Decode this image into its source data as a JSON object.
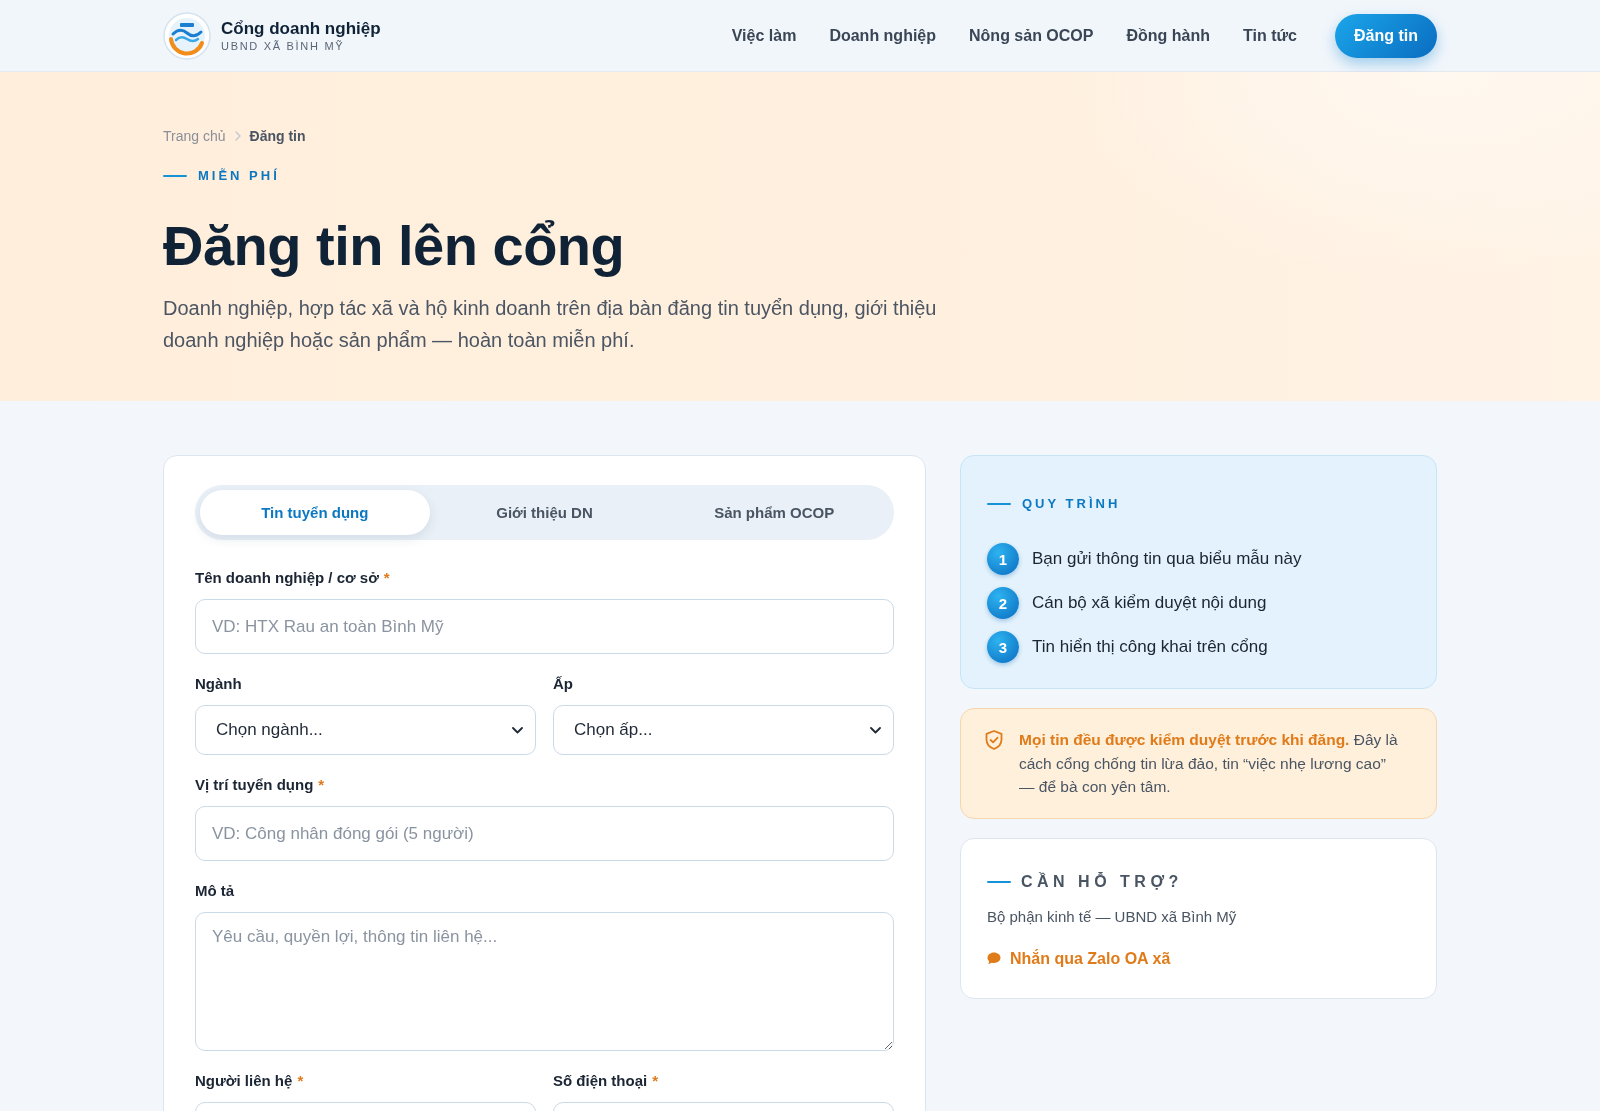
{
  "header": {
    "brand": {
      "title": "Cổng doanh nghiệp",
      "subtitle": "UBND XÃ BÌNH MỸ"
    },
    "nav": [
      "Việc làm",
      "Doanh nghiệp",
      "Nông sản OCOP",
      "Đồng hành",
      "Tin tức"
    ],
    "cta": "Đăng tin"
  },
  "hero": {
    "breadcrumb": [
      {
        "label": "Trang chủ",
        "current": false
      },
      {
        "label": "Đăng tin",
        "current": true
      }
    ],
    "eyebrow": "MIỄN PHÍ",
    "title": "Đăng tin lên cổng",
    "description": "Doanh nghiệp, hợp tác xã và hộ kinh doanh trên địa bàn đăng tin tuyển dụng, giới thiệu doanh nghiệp hoặc sản phẩm — hoàn toàn miễn phí."
  },
  "form": {
    "tabs": [
      {
        "label": "Tin tuyển dụng",
        "selected": true
      },
      {
        "label": "Giới thiệu DN",
        "selected": false
      },
      {
        "label": "Sản phẩm OCOP",
        "selected": false
      }
    ],
    "rows": [
      {
        "fields": [
          {
            "kind": "text",
            "label": "Tên doanh nghiệp / cơ sở",
            "required_mark": "*",
            "placeholder": "VD: HTX Rau an toàn Bình Mỹ"
          }
        ]
      },
      {
        "fields": [
          {
            "kind": "select",
            "label": "Ngành",
            "value": "Chọn ngành..."
          },
          {
            "kind": "select",
            "label": "Ấp",
            "value": "Chọn ấp..."
          }
        ]
      },
      {
        "fields": [
          {
            "kind": "text",
            "label": "Vị trí tuyển dụng",
            "required_mark": "*",
            "placeholder": "VD: Công nhân đóng gói (5 người)"
          }
        ]
      },
      {
        "fields": [
          {
            "kind": "textarea",
            "label": "Mô tả",
            "placeholder": "Yêu cầu, quyền lợi, thông tin liên hệ..."
          }
        ]
      },
      {
        "fields": [
          {
            "kind": "text",
            "label": "Người liên hệ",
            "required_mark": "*"
          },
          {
            "kind": "text",
            "label": "Số điện thoại",
            "required_mark": "*"
          }
        ]
      }
    ]
  },
  "sidebar": {
    "process": {
      "eyebrow": "QUY TRÌNH",
      "steps": [
        {
          "number": "1",
          "text": "Bạn gửi thông tin qua biểu mẫu này"
        },
        {
          "number": "2",
          "text": "Cán bộ xã kiểm duyệt nội dung"
        },
        {
          "number": "3",
          "text": "Tin hiển thị công khai trên cổng"
        }
      ]
    },
    "notice": {
      "text": "**Mọi tin đều được kiểm duyệt trước khi đăng.** Đây là cách cổng chống tin lừa đảo, tin “việc nhẹ lương cao” — để bà con yên tâm."
    },
    "support": {
      "eyebrow": "CẦN HỖ TRỢ?",
      "text": "Bộ phận kinh tế — UBND xã Bình Mỹ",
      "link": "Nhắn qua Zalo OA xã"
    }
  }
}
